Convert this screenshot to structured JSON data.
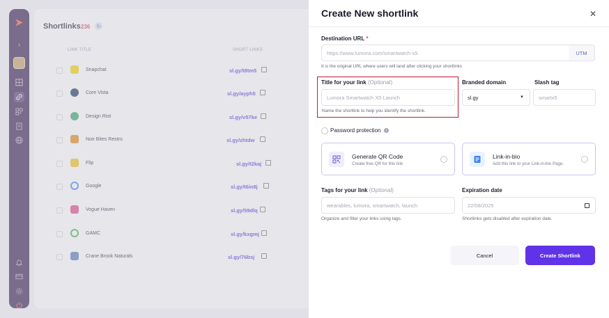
{
  "background": {
    "page_title": "Shortlinks",
    "count": "236",
    "columns": {
      "link_title": "LINK TITLE",
      "short_links": "SHORT LINKS"
    },
    "rows": [
      {
        "title": "Snapchat",
        "short": "sl.gy/t8tm5",
        "color": "#f7d600"
      },
      {
        "title": "Core Vista",
        "short": "sl.gy/ayph5",
        "color": "#1e3a5f"
      },
      {
        "title": "Design Riot",
        "short": "sl.gy/v57ke",
        "color": "#3aa86b"
      },
      {
        "title": "Noir Bites Restro",
        "short": "sl.gy/zhtdw",
        "color": "#e88a1a"
      },
      {
        "title": "Flip",
        "short": "sl.gy/t2kaj",
        "color": "#f5c518"
      },
      {
        "title": "Google",
        "short": "sl.gy/t6in8j",
        "color": "#4285f4"
      },
      {
        "title": "Vogue Haven",
        "short": "sl.gy/59dlq",
        "color": "#e84a8a"
      },
      {
        "title": "GAMC",
        "short": "sl.gy/kxgmj",
        "color": "#4caf50"
      },
      {
        "title": "Crane Brook Naturals",
        "short": "sl.gy/76bsj",
        "color": "#5a7fb8"
      }
    ]
  },
  "modal": {
    "title": "Create New shortlink",
    "destination": {
      "label": "Destination URL",
      "required_mark": "*",
      "placeholder": "https://www.lumora.com/smartwatch-x5",
      "utm": "UTM",
      "hint": "It is the original URL where users will land after clicking your shortlinks"
    },
    "title_field": {
      "label": "Title for your link",
      "optional": "(Optional)",
      "placeholder": "Lumora Smartwatch X5 Launch",
      "hint": "Name the shortlink to help you identify the shortlink."
    },
    "branded_domain": {
      "label": "Branded domain",
      "value": "sl.gy"
    },
    "slash_tag": {
      "label": "Slash tag",
      "placeholder": "smartx5"
    },
    "password": {
      "label": "Password protection"
    },
    "qr_card": {
      "title": "Generate QR Code",
      "subtitle": "Create free QR for this link"
    },
    "bio_card": {
      "title": "Link-in-bio",
      "subtitle": "Add this link to your Link-in-bio Page."
    },
    "tags": {
      "label": "Tags for your link",
      "optional": "(Optional)",
      "placeholder": "wearables, lumora, smartwatch, launch",
      "hint": "Organize and filter your links using tags."
    },
    "expiration": {
      "label": "Expiration date",
      "value": "22/08/2025",
      "hint": "Shortlinks gets disabled after expiration  date."
    },
    "cancel": "Cancel",
    "create": "Create Shortlink"
  },
  "colors": {
    "accent": "#6032e8",
    "sidebar": "#3a2450",
    "highlight": "#c0192b"
  }
}
